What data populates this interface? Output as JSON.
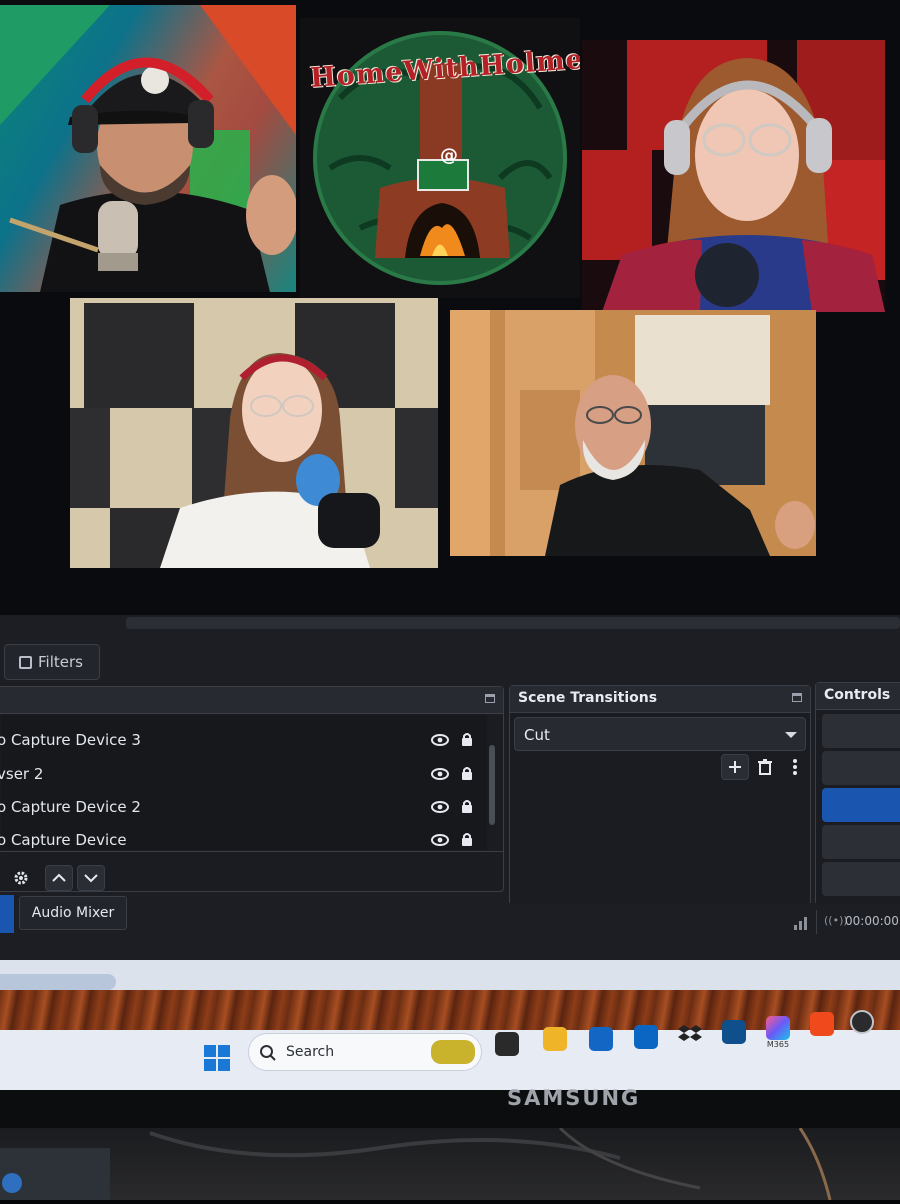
{
  "preview": {
    "logo_text": "HomeWithHolmes",
    "logo_symbol": "@"
  },
  "panels": {
    "filters_button": "Filters",
    "sources": {
      "items": [
        {
          "label": "o Capture Device 3"
        },
        {
          "label": "vser 2"
        },
        {
          "label": "o Capture Device 2"
        },
        {
          "label": "o Capture Device"
        }
      ]
    },
    "scene_transitions": {
      "title": "Scene Transitions",
      "selected": "Cut"
    },
    "controls": {
      "title": "Controls"
    },
    "audio_mixer_tab": "Audio Mixer",
    "status": {
      "timer": "00:00:00"
    }
  },
  "taskbar": {
    "search_placeholder": "Search",
    "m365_label": "M365"
  },
  "monitor": {
    "brand": "SAMSUNG"
  },
  "colors": {
    "obs_bg": "#1c1e23",
    "accent_blue": "#1a56b0",
    "taskbar_bg": "#e7ebf3"
  }
}
